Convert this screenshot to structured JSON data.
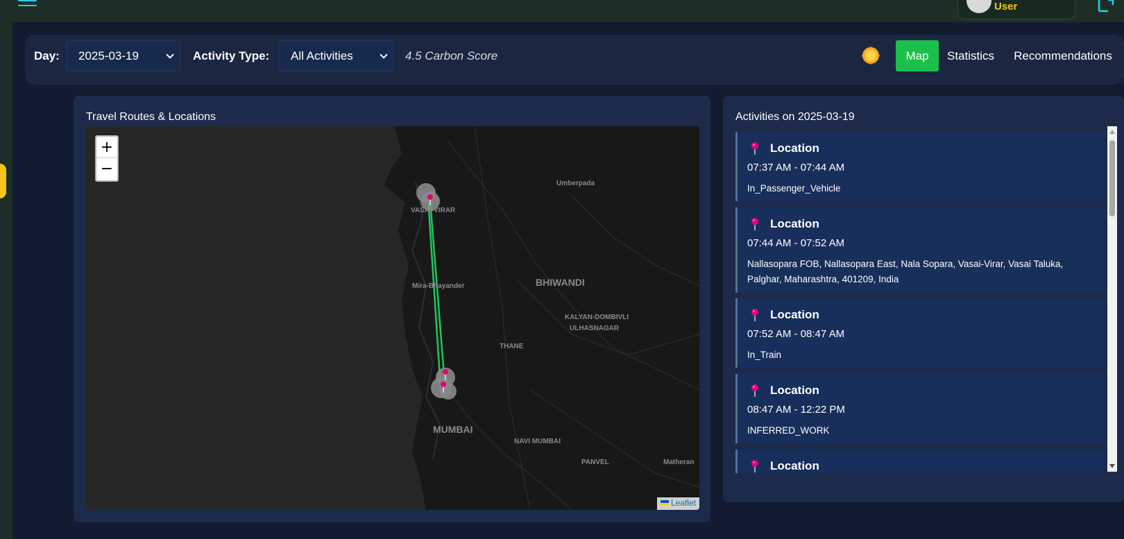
{
  "header": {
    "user_name": "User",
    "menu_icon": "hamburger-icon",
    "logout_icon": "logout-icon",
    "avatar_icon": "user-avatar-icon"
  },
  "filters": {
    "day_label": "Day:",
    "day_value": "2025-03-19",
    "activity_type_label": "Activity Type:",
    "activity_type_value": "All Activities",
    "carbon_score": "4.5 Carbon Score",
    "theme_icon": "sun-icon"
  },
  "tabs": [
    {
      "label": "Map",
      "active": true
    },
    {
      "label": "Statistics",
      "active": false
    },
    {
      "label": "Recommendations",
      "active": false
    }
  ],
  "map_panel": {
    "title": "Travel Routes & Locations",
    "zoom_in": "+",
    "zoom_out": "−",
    "attribution": "Leaflet",
    "place_labels": [
      "Umberpada",
      "VASAI-VIRAR",
      "Mira-Bhayander",
      "BHIWANDI",
      "KALYAN-DOMBIVLI",
      "ULHASNAGAR",
      "THANE",
      "MUMBAI",
      "NAVI MUMBAI",
      "PANVEL",
      "Matheran"
    ],
    "route_color": "#22c55e",
    "marker_color": "#e6007a"
  },
  "activities_panel": {
    "title": "Activities on 2025-03-19",
    "items": [
      {
        "title": "Location",
        "time": "07:37 AM - 07:44 AM",
        "description": "In_Passenger_Vehicle"
      },
      {
        "title": "Location",
        "time": "07:44 AM - 07:52 AM",
        "description": "Nallasopara FOB, Nallasopara East, Nala Sopara, Vasai-Virar, Vasai Taluka, Palghar, Maharashtra, 401209, India"
      },
      {
        "title": "Location",
        "time": "07:52 AM - 08:47 AM",
        "description": "In_Train"
      },
      {
        "title": "Location",
        "time": "08:47 AM - 12:22 PM",
        "description": "INFERRED_WORK"
      },
      {
        "title": "Location",
        "time": "",
        "description": ""
      }
    ]
  },
  "colors": {
    "accent_green": "#1bbf4b",
    "user_name_yellow": "#f5c518",
    "cyan": "#22d3ee",
    "pin_pink": "#e6007a"
  }
}
